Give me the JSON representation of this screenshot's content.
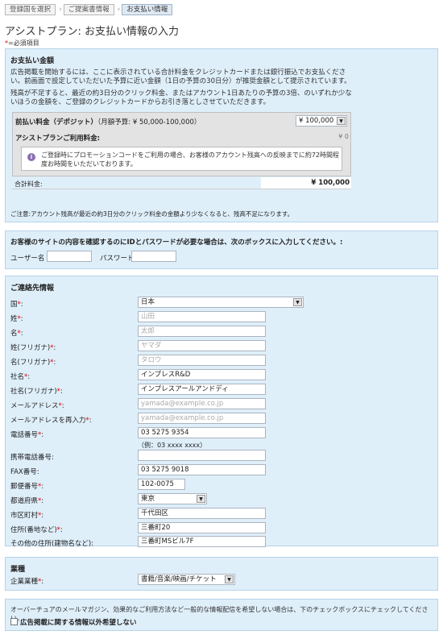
{
  "breadcrumb": {
    "step1": "登録国を選択",
    "step2": "ご提案書情報",
    "step3": "お支払い情報"
  },
  "page": {
    "title": "アシストプラン: お支払い情報の入力",
    "required_note": "=必須項目",
    "required_mark": "*"
  },
  "payment": {
    "heading": "お支払い金額",
    "para1": "広告掲載を開始するには、ここに表示されている合計料金をクレジットカードまたは銀行振込でお支払ください。前画面で設定していただいた予算に近い金額（1日の予算の30日分）が推奨金額として提示されています。",
    "para2": "残高が不足すると、最近の約3日分のクリック料金、またはアカウント1日あたりの予算の3倍、のいずれか少ないほうの金額を、ご登録のクレジットカードからお引き落としさせていただきます。",
    "prepay_label": "前払い料金（デポジット）",
    "prepay_budget": "（月額予算: ¥ 50,000-100,000）",
    "prepay_value": "¥ 100,000",
    "usage_label": "アシストプランご利用料金:",
    "usage_value": "¥ 0",
    "info_text": "ご登録時にプロモーションコードをご利用の場合、お客様のアカウント残高への反映までに約72時間程度お時間をいただいております。",
    "total_label": "合計料金:",
    "total_value": "¥ 100,000",
    "note_prefix": "ご注意:",
    "note": "アカウント残高が最近の約3日分のクリック料金の金額より少なくなると、残高不足になります。"
  },
  "site_auth": {
    "heading": "お客様のサイトの内容を確認するのにIDとパスワードが必要な場合は、次のボックスに入力してください。:",
    "user_label": "ユーザー名",
    "pass_label": "パスワード",
    "user_value": "",
    "pass_value": ""
  },
  "contact": {
    "heading": "ご連絡先情報",
    "country_label": "国",
    "country_value": "日本",
    "last_name_label": "姓",
    "last_name_value": "山田",
    "first_name_label": "名",
    "first_name_value": "太郎",
    "last_kana_label": "姓(フリガナ)",
    "last_kana_value": "ヤマダ",
    "first_kana_label": "名(フリガナ)",
    "first_kana_value": "タロウ",
    "company_label": "社名",
    "company_value": "インプレスR&D",
    "company_kana_label": "社名(フリガナ)",
    "company_kana_value": "インプレスアールアンドディ",
    "email_label": "メールアドレス",
    "email_value": "yamada@example.co.jp",
    "email2_label": "メールアドレスを再入力",
    "email2_value": "yamada@example.co.jp",
    "phone_label": "電話番号",
    "phone_value": "03 5275 9354",
    "phone_hint": "（例：03 xxxx xxxx）",
    "mobile_label": "携帯電話番号",
    "mobile_value": "",
    "fax_label": "FAX番号",
    "fax_value": "03 5275 9018",
    "zip_label": "郵便番号",
    "zip_value": "102-0075",
    "pref_label": "都道府県",
    "pref_value": "東京",
    "city_label": "市区町村",
    "city_value": "千代田区",
    "addr_label": "住所(番地など)",
    "addr_value": "三番町20",
    "addr2_label": "その他の住所(建物名など)",
    "addr2_value": "三番町MSビル7F"
  },
  "industry": {
    "heading": "業種",
    "label": "企業業種",
    "value": "書籍/音楽/映画/チケット"
  },
  "newsletter": {
    "text": "オーバーチュアのメールマガジン、効果的なご利用方法など一般的な情報配信を希望しない場合は、下のチェックボックスにチェックしてください。",
    "checkbox_label": "広告掲載に関する情報以外希望しない"
  },
  "colors": {
    "panel": "#dfeffa",
    "panel_border": "#b7d3e8",
    "required": "#dd0000"
  }
}
